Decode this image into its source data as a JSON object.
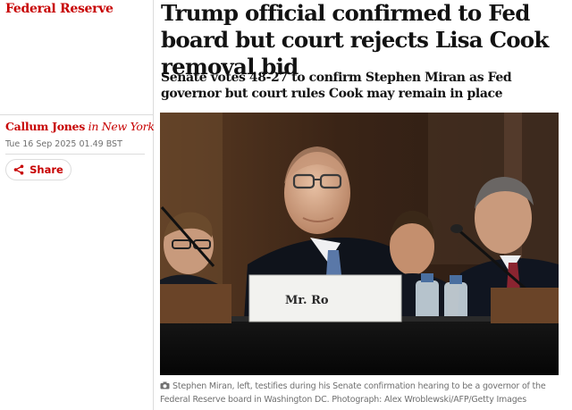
{
  "section": {
    "label": "Federal Reserve"
  },
  "article": {
    "headline": "Trump official confirmed to Fed board but court rejects Lisa Cook removal bid",
    "standfirst": "Senate votes 48-27 to confirm Stephen Miran as Fed governor but court rules Cook may remain in place",
    "photo": {
      "nameplate_text": "Mr. Ro"
    },
    "caption": "Stephen Miran, left, testifies during his Senate confirmation hearing to be a governor of the Federal Reserve board in Washington DC. Photograph: Alex Wroblewski/AFP/Getty Images"
  },
  "byline": {
    "author": "Callum Jones",
    "location": "in New York"
  },
  "dateline": "Tue 16 Sep 2025 01.49 BST",
  "share": {
    "label": "Share",
    "icon": "share-icon"
  },
  "colors": {
    "accent": "#c70000",
    "text": "#121212",
    "muted": "#707070",
    "rule": "#dcdcdc"
  }
}
